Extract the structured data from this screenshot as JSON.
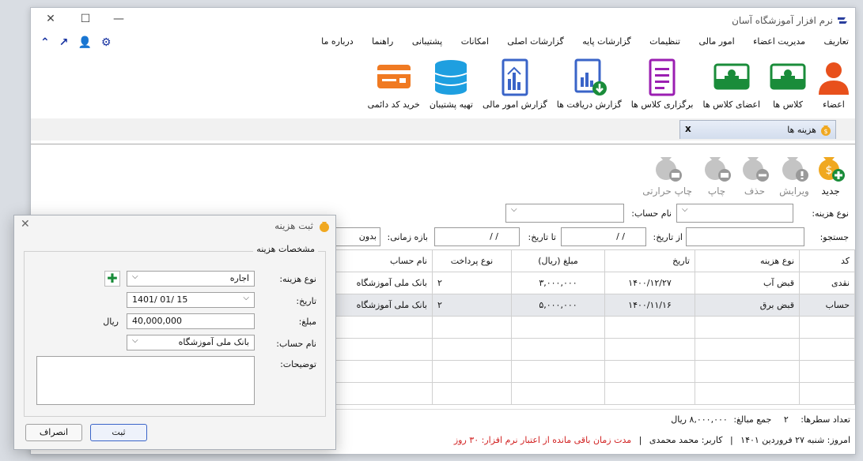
{
  "app": {
    "title": "نرم افزار آموزشگاه آسان"
  },
  "window": {
    "minimize": "—",
    "maximize": "☐",
    "close": "✕"
  },
  "menu": [
    "تعاریف",
    "مدیریت اعضاء",
    "امور مالی",
    "تنظیمات",
    "گزارشات پایه",
    "گزارشات اصلی",
    "امکانات",
    "پشتیبانی",
    "راهنما",
    "درباره ما"
  ],
  "quick": {
    "up": "⌃",
    "arrow": "↗",
    "user": "👤",
    "gear": "⚙"
  },
  "ribbon": [
    {
      "label": "اعضاء"
    },
    {
      "label": "کلاس ها"
    },
    {
      "label": "اعضای کلاس ها"
    },
    {
      "label": "برگزاری کلاس ها"
    },
    {
      "label": "گزارش دریافت ها"
    },
    {
      "label": "گزارش امور مالی"
    },
    {
      "label": "تهیه پشتیبان"
    },
    {
      "label": "خرید کد دائمی"
    }
  ],
  "tab": {
    "label": "هزینه ها",
    "close": "x"
  },
  "toolbar": {
    "new": "جدید",
    "edit": "ویرایش",
    "delete": "حذف",
    "print": "چاپ",
    "print_thermal": "چاپ حرارتی"
  },
  "filters": {
    "cost_type_label": "نوع هزینه:",
    "account_label": "نام حساب:",
    "search_label": "جستجو:",
    "from_label": "از تاریخ:",
    "from_value": "/ /",
    "to_label": "تا تاریخ:",
    "to_value": "/ /",
    "period_label": "بازه زمانی:",
    "period_value": "بدون"
  },
  "table": {
    "columns": [
      "کد",
      "نوع هزینه",
      "تاریخ",
      "مبلغ (ریال)",
      "نوع پرداخت",
      "نام حساب"
    ],
    "rows": [
      [
        "نقدی",
        "قبض آب",
        "۱۴۰۰/۱۲/۲۷",
        "۳,۰۰۰,۰۰۰",
        "۲",
        "بانک ملی آموزشگاه"
      ],
      [
        "حساب",
        "قبض برق",
        "۱۴۰۰/۱۱/۱۶",
        "۵,۰۰۰,۰۰۰",
        "۲",
        "بانک ملی آموزشگاه"
      ]
    ]
  },
  "status": {
    "rows_label": "تعداد سطرها:",
    "rows_value": "۲",
    "sum_label": "جمع مبالغ:",
    "sum_value": "۸,۰۰۰,۰۰۰ ریال",
    "today": "امروز: شنبه ۲۷ فروردین ۱۴۰۱",
    "user": "کاربر: محمد محمدی",
    "license": "مدت زمان باقی مانده از اعتبار نرم افزار: ۳۰ روز"
  },
  "dialog": {
    "title": "ثبت هزینه",
    "group": "مشخصات هزینه",
    "type_label": "نوع هزینه:",
    "type_value": "اجاره",
    "date_label": "تاریخ:",
    "date_value": "1401/ 01/ 15",
    "amount_label": "مبلغ:",
    "amount_value": "40,000,000",
    "unit": "ریال",
    "account_label": "نام حساب:",
    "account_value": "بانک ملی آموزشگاه",
    "notes_label": "توضیحات:",
    "save": "ثبت",
    "cancel": "انصراف",
    "close": "✕"
  },
  "colors": {
    "accent": "#1f3ea8",
    "green": "#1a8c3a",
    "orange": "#f07a22",
    "license_red": "#d12020"
  }
}
